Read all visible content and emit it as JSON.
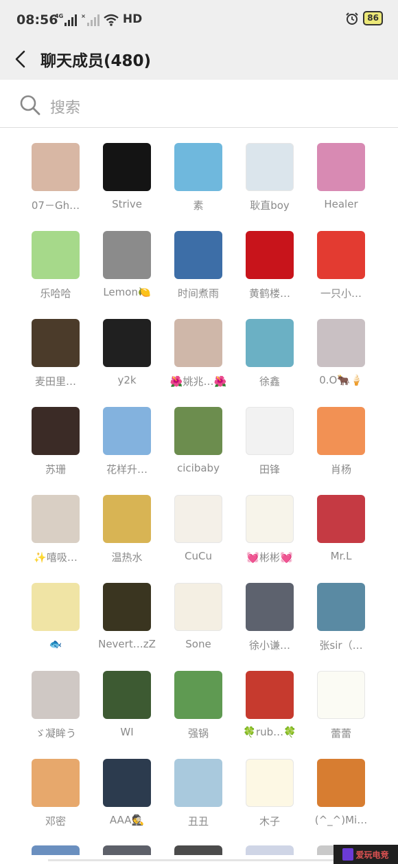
{
  "status_bar": {
    "time": "08:56",
    "network_label_1": "4G",
    "network_label_2": "×",
    "hd_label": "HD",
    "battery": "86"
  },
  "header": {
    "title": "聊天成员(480)"
  },
  "search": {
    "placeholder": "搜索"
  },
  "members": [
    {
      "name": "07－Gh…",
      "avatar_color": "#d8b7a4"
    },
    {
      "name": "Strive",
      "avatar_color": "#141414"
    },
    {
      "name": "素",
      "avatar_color": "#6fb8dd"
    },
    {
      "name": "耿直boy",
      "avatar_color": "#dbe5ec"
    },
    {
      "name": "Healer",
      "avatar_color": "#d88ab3"
    },
    {
      "name": "乐哈哈",
      "avatar_color": "#a6d98a"
    },
    {
      "name": "Lemon🍋",
      "avatar_color": "#8b8b8b"
    },
    {
      "name": "时间煮雨",
      "avatar_color": "#3d6ea7"
    },
    {
      "name": "黄鹤楼…",
      "avatar_color": "#c8141b"
    },
    {
      "name": "一只小…",
      "avatar_color": "#e33b31"
    },
    {
      "name": "麦田里…",
      "avatar_color": "#4b3b2a"
    },
    {
      "name": "y2k",
      "avatar_color": "#202020"
    },
    {
      "name": "🌺姚兆…🌺",
      "avatar_color": "#cfb7a9"
    },
    {
      "name": "徐鑫",
      "avatar_color": "#6bb0c4"
    },
    {
      "name": "0.O🐂🍦",
      "avatar_color": "#c9c0c3"
    },
    {
      "name": "苏珊",
      "avatar_color": "#3b2b26"
    },
    {
      "name": "花样升…",
      "avatar_color": "#83b2de"
    },
    {
      "name": "cicibaby",
      "avatar_color": "#6c8d4e"
    },
    {
      "name": "田锋",
      "avatar_color": "#f2f2f2"
    },
    {
      "name": "肖杨",
      "avatar_color": "#f29154"
    },
    {
      "name": "✨嘻吸…",
      "avatar_color": "#d9cfc4"
    },
    {
      "name": "温热水",
      "avatar_color": "#d8b454"
    },
    {
      "name": "CuCu",
      "avatar_color": "#f4f0e8"
    },
    {
      "name": "💓彬彬💓",
      "avatar_color": "#f7f4ea"
    },
    {
      "name": "Mr.L",
      "avatar_color": "#c53a43"
    },
    {
      "name": "🐟",
      "avatar_color": "#f0e4a5"
    },
    {
      "name": "Nevert…zZ",
      "avatar_color": "#3a3520"
    },
    {
      "name": "Sone",
      "avatar_color": "#f4efe3"
    },
    {
      "name": "徐小谦…",
      "avatar_color": "#5d626e"
    },
    {
      "name": "张sir（…",
      "avatar_color": "#5a8aa3"
    },
    {
      "name": "ゞ凝眸う",
      "avatar_color": "#cfc8c4"
    },
    {
      "name": "WI",
      "avatar_color": "#3d5a32"
    },
    {
      "name": "强锅",
      "avatar_color": "#5f9a52"
    },
    {
      "name": "🍀rub…🍀",
      "avatar_color": "#c63a2e"
    },
    {
      "name": "蕾蕾",
      "avatar_color": "#fbfbf4"
    },
    {
      "name": "邓密",
      "avatar_color": "#e7a86c"
    },
    {
      "name": "AAA🕵",
      "avatar_color": "#2c3b4e"
    },
    {
      "name": "丑丑",
      "avatar_color": "#a9c9dd"
    },
    {
      "name": "木子",
      "avatar_color": "#fdf8e4"
    },
    {
      "name": "(^_^)Mi…",
      "avatar_color": "#d77d31"
    }
  ],
  "partial_row_colors": [
    "#6a8fbf",
    "#5d6069",
    "#4b4b4b",
    "#cfd5e6",
    "#c9c9c9"
  ],
  "watermark": {
    "text": "爱玩电竞"
  }
}
